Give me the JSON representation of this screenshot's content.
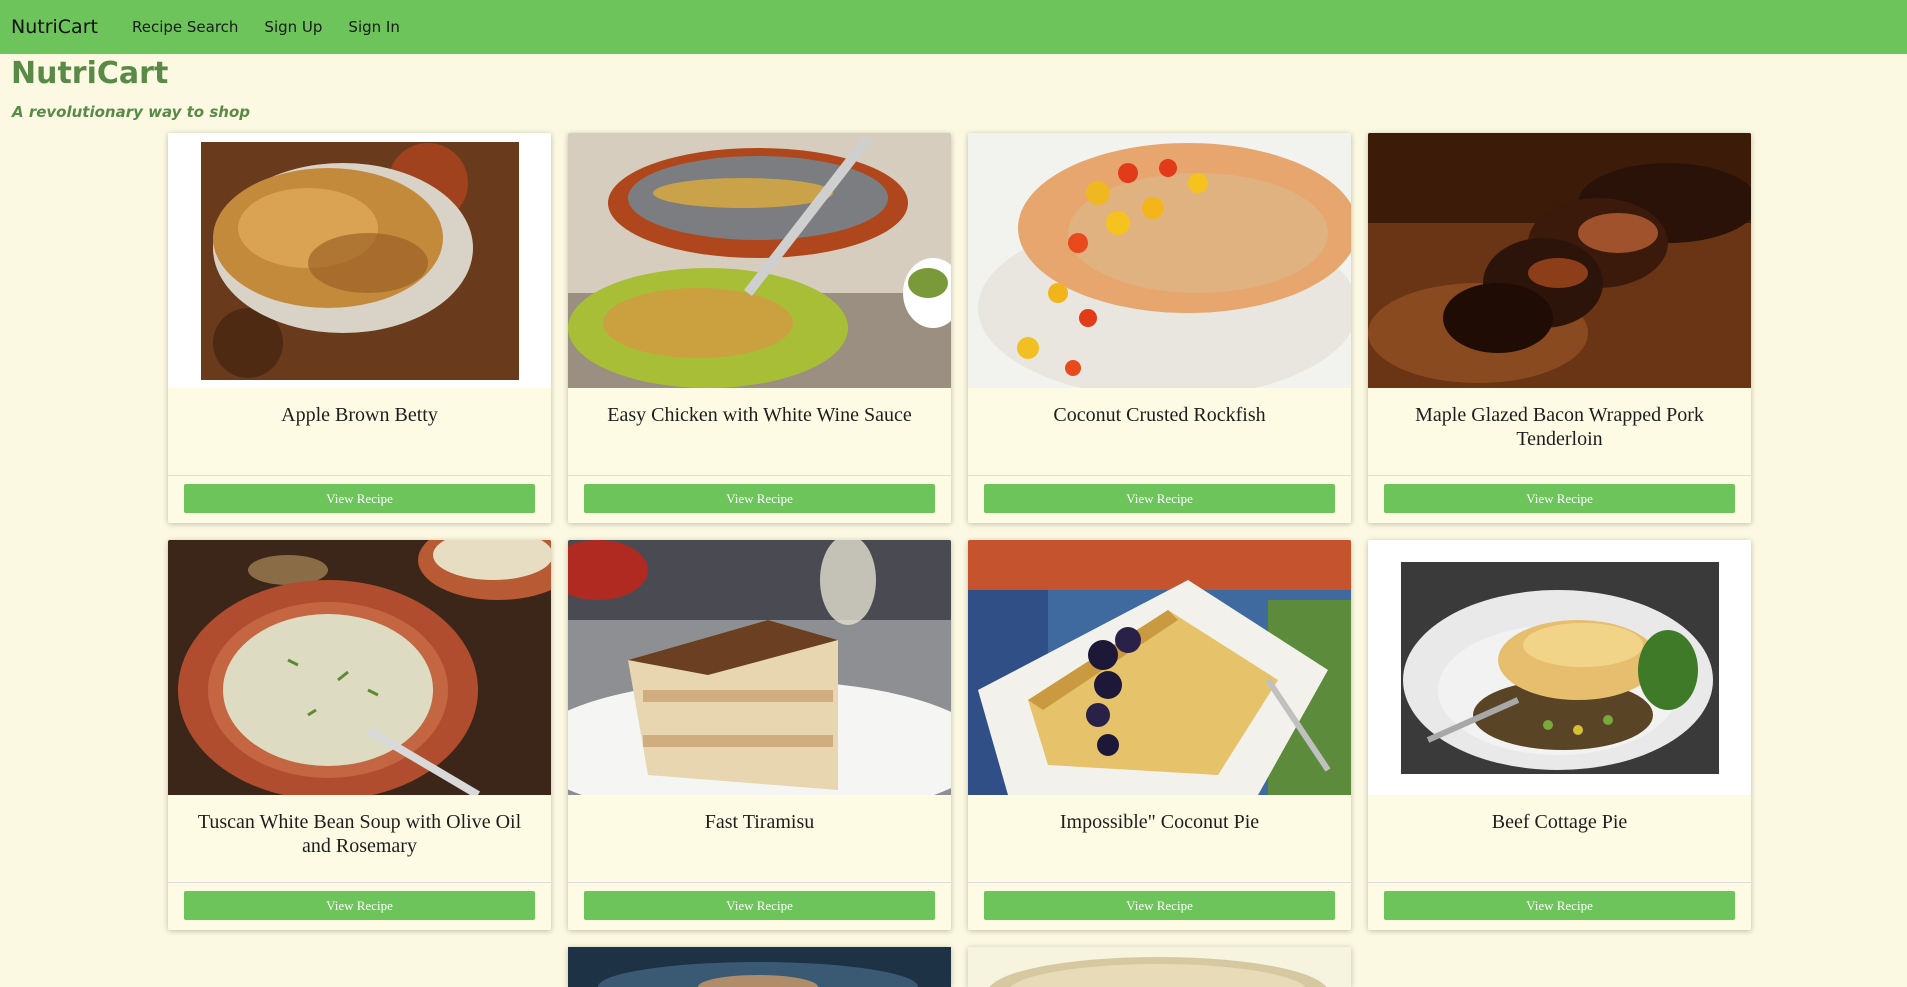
{
  "nav": {
    "brand": "NutriCart",
    "links": [
      "Recipe Search",
      "Sign Up",
      "Sign In"
    ]
  },
  "header": {
    "title": "NutriCart",
    "tagline": "A revolutionary way to shop"
  },
  "recipes": [
    {
      "title": "Apple Brown Betty",
      "button": "View Recipe"
    },
    {
      "title": "Easy Chicken with White Wine Sauce",
      "button": "View Recipe"
    },
    {
      "title": "Coconut Crusted Rockfish",
      "button": "View Recipe"
    },
    {
      "title": "Maple Glazed Bacon Wrapped Pork Tenderloin",
      "button": "View Recipe"
    },
    {
      "title": "Tuscan White Bean Soup with Olive Oil and Rosemary",
      "button": "View Recipe"
    },
    {
      "title": "Fast Tiramisu",
      "button": "View Recipe"
    },
    {
      "title": "Impossible\" Coconut Pie",
      "button": "View Recipe"
    },
    {
      "title": "Beef Cottage Pie",
      "button": "View Recipe"
    }
  ],
  "colors": {
    "navbar": "#6cc45a",
    "background": "#fcf9e2",
    "heading": "#5a8a47",
    "button": "#6cc45a"
  }
}
